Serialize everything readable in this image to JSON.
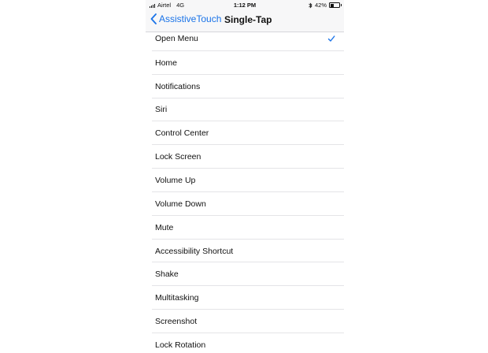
{
  "status_bar": {
    "carrier": "Airtel",
    "network": "4G",
    "time": "1:12 PM",
    "battery_text": "42%",
    "battery_level": 0.42,
    "icons": [
      "signal-icon",
      "bluetooth-icon",
      "battery-icon"
    ]
  },
  "nav": {
    "back_label": "AssistiveTouch",
    "title": "Single-Tap"
  },
  "colors": {
    "accent": "#1a73e8"
  },
  "options": [
    {
      "label": "Open Menu",
      "selected": true
    },
    {
      "label": "Home",
      "selected": false
    },
    {
      "label": "Notifications",
      "selected": false
    },
    {
      "label": "Siri",
      "selected": false
    },
    {
      "label": "Control Center",
      "selected": false
    },
    {
      "label": "Lock Screen",
      "selected": false
    },
    {
      "label": "Volume Up",
      "selected": false
    },
    {
      "label": "Volume Down",
      "selected": false
    },
    {
      "label": "Mute",
      "selected": false
    },
    {
      "label": "Accessibility Shortcut",
      "selected": false
    },
    {
      "label": "Shake",
      "selected": false
    },
    {
      "label": "Multitasking",
      "selected": false
    },
    {
      "label": "Screenshot",
      "selected": false
    },
    {
      "label": "Lock Rotation",
      "selected": false
    }
  ]
}
